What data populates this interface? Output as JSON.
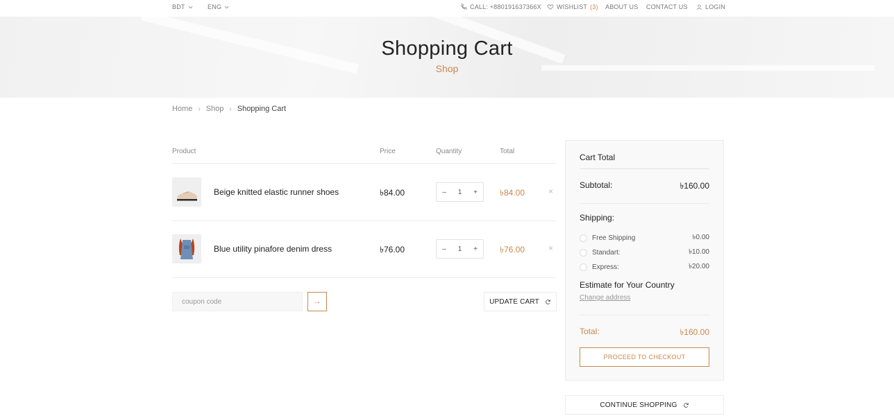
{
  "topbar": {
    "currency": "BDT",
    "language": "ENG",
    "call": "CALL: +880191637366X",
    "wishlist_label": "WISHLIST",
    "wishlist_count": "(3)",
    "about": "ABOUT US",
    "contact": "CONTACT US",
    "login": "LOGIN"
  },
  "hero": {
    "title": "Shopping Cart",
    "subtitle": "Shop"
  },
  "breadcrumb": {
    "items": [
      "Home",
      "Shop",
      "Shopping Cart"
    ]
  },
  "table": {
    "headers": {
      "product": "Product",
      "price": "Price",
      "quantity": "Quantity",
      "total": "Total"
    },
    "rows": [
      {
        "name": "Beige knitted elastic runner shoes",
        "price": "৳84.00",
        "qty": "1",
        "total": "৳84.00"
      },
      {
        "name": "Blue utility pinafore denim dress",
        "price": "৳76.00",
        "qty": "1",
        "total": "৳76.00"
      }
    ],
    "minus": "–",
    "plus": "+",
    "remove": "×"
  },
  "coupon": {
    "placeholder": "coupon code",
    "go": "→"
  },
  "update_cart": "UPDATE CART",
  "cart_total": {
    "title": "Cart Total",
    "subtotal_label": "Subtotal:",
    "subtotal_value": "৳160.00",
    "shipping_label": "Shipping:",
    "options": [
      {
        "label": "Free Shipping",
        "value": "৳0.00"
      },
      {
        "label": "Standart:",
        "value": "৳10.00"
      },
      {
        "label": "Express:",
        "value": "৳20.00"
      }
    ],
    "estimate_label": "Estimate for Your Country",
    "change_address": "Change address",
    "total_label": "Total:",
    "total_value": "৳160.00",
    "checkout": "PROCEED TO CHECKOUT"
  },
  "continue_shopping": "CONTINUE SHOPPING",
  "colors": {
    "accent": "#c8884b",
    "text": "#222222",
    "muted": "#888888"
  }
}
